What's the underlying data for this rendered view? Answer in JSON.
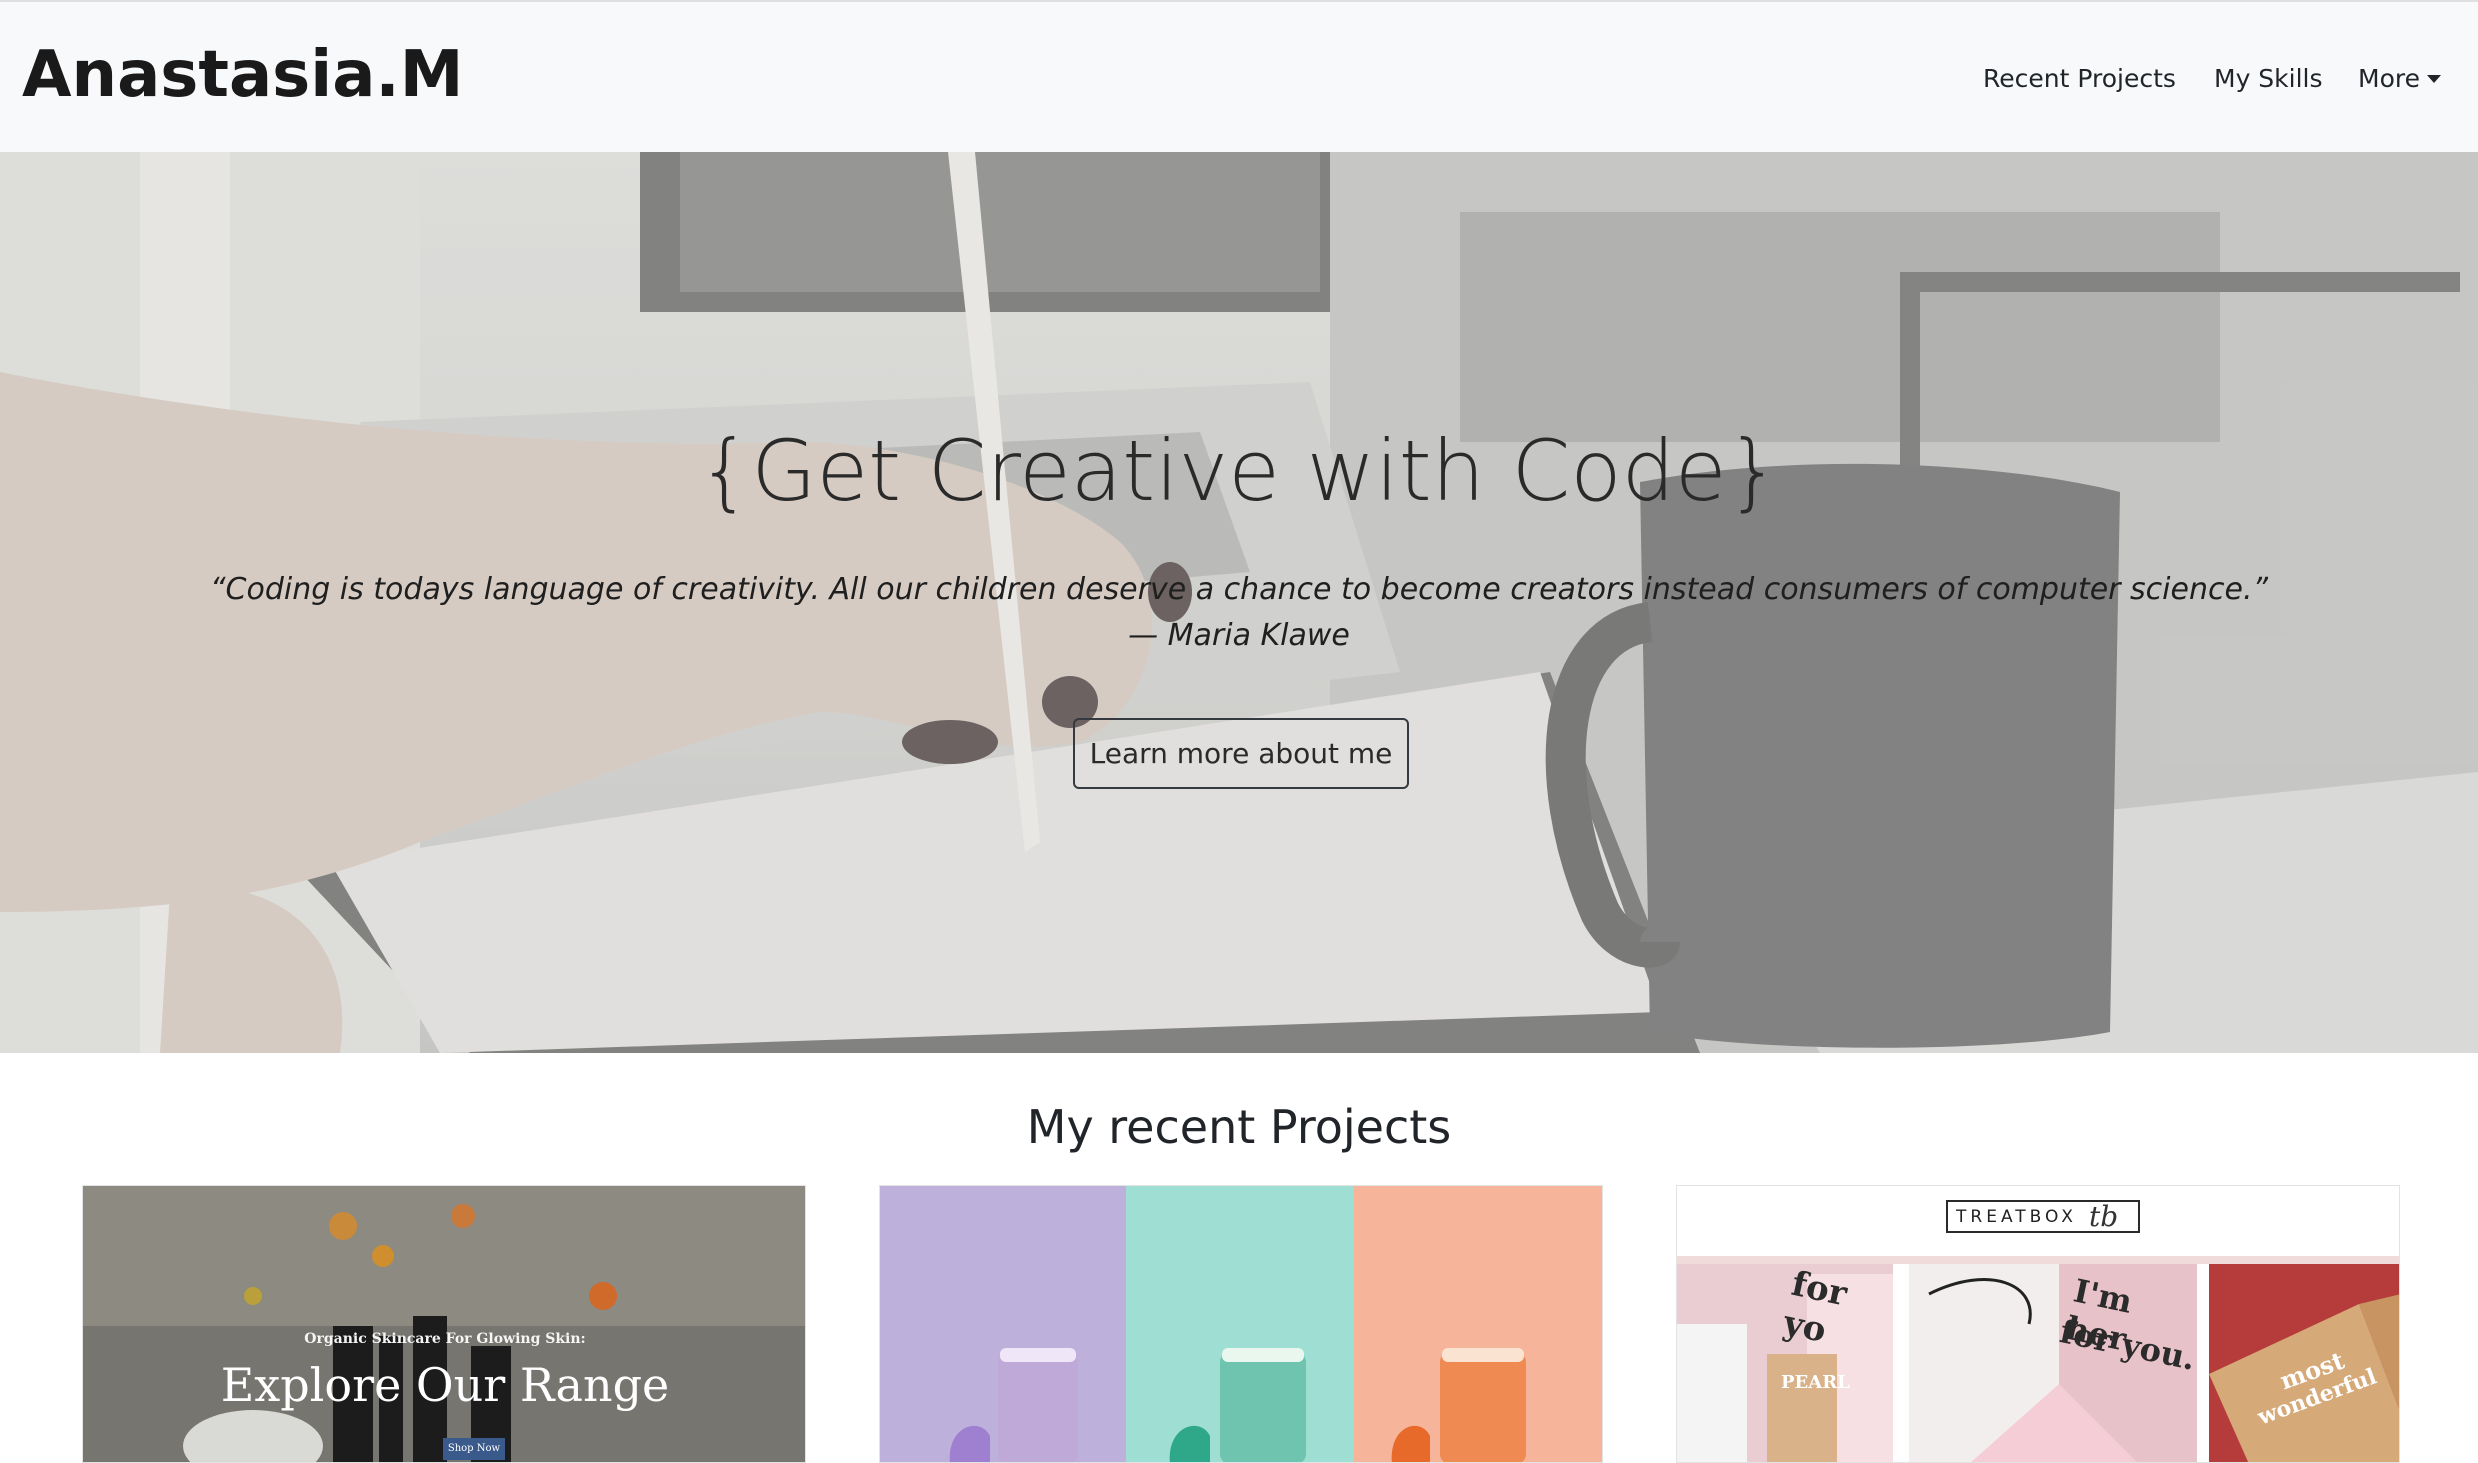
{
  "navbar": {
    "brand": "Anastasia.M",
    "links": [
      {
        "label": "Recent Projects"
      },
      {
        "label": "My Skills"
      },
      {
        "label": "More"
      }
    ]
  },
  "hero": {
    "title": "{Get Creative with Code}",
    "quote": "“Coding is todays language of creativity. All our children deserve a chance to become creators instead consumers of computer science.”",
    "author": "— Maria Klawe",
    "button_label": "Learn more about me"
  },
  "projects": {
    "heading": "My recent Projects",
    "cards": [
      {
        "subtitle": "Organic Skincare For Glowing Skin:",
        "title": "Explore Our Range",
        "button": "Shop Now"
      },
      {
        "panel_colors": [
          "#bdb1dc",
          "#9fded2",
          "#f6b49a"
        ]
      },
      {
        "logo": "TREATBOX",
        "logo_mark": "tb",
        "image_texts": [
          "for yo",
          "PEARL",
          "I'm her",
          "for you.",
          "most",
          "wonderful"
        ]
      }
    ]
  }
}
